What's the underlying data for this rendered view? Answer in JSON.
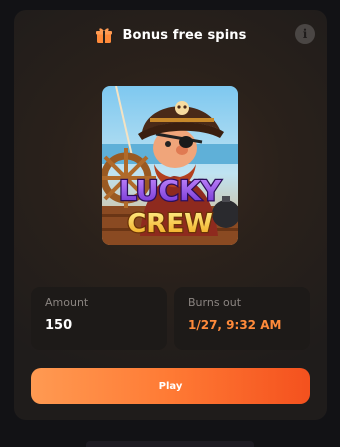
{
  "header": {
    "title": "Bonus free spins",
    "icon": "gift-icon",
    "info_icon_glyph": "i"
  },
  "game": {
    "logo_line1": "LUCKY",
    "logo_line2": "CREW"
  },
  "details": {
    "amount_label": "Amount",
    "amount_value": "150",
    "burns_label": "Burns out",
    "burns_value": "1/27, 9:32 AM"
  },
  "actions": {
    "play_label": "Play"
  },
  "colors": {
    "accent_orange": "#ff8a3a",
    "button_start": "#ff9a52",
    "button_end": "#f4511e"
  }
}
